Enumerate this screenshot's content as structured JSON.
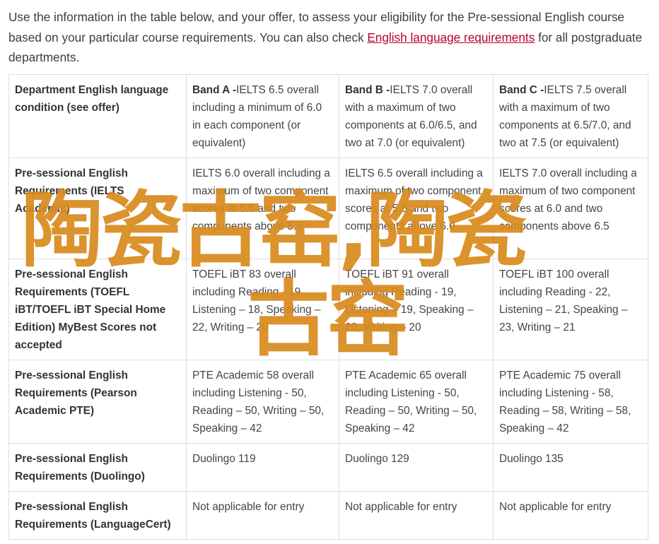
{
  "intro": {
    "text_before": "Use the information in the table below, and your offer, to assess your eligibility for the Pre-sessional English course based on your particular course requirements. You can also check ",
    "link": "English language requirements",
    "text_after": " for all postgraduate departments."
  },
  "table": {
    "header": {
      "col1": "Department English language condition (see offer)",
      "bands": [
        {
          "band": "Band A -",
          "desc": "IELTS 6.5 overall including a minimum of 6.0 in each component (or equivalent)"
        },
        {
          "band": "Band B -",
          "desc": "IELTS 7.0 overall with a maximum of two components at 6.0/6.5, and two at 7.0 (or equivalent)"
        },
        {
          "band": "Band C -",
          "desc": "IELTS 7.5 overall with a maximum of two components at 6.5/7.0, and two at 7.5 (or equivalent)"
        }
      ]
    },
    "rows": [
      {
        "label": "Pre-sessional English Requirements (IELTS Academic)",
        "cells": [
          "IELTS 6.0 overall including a maximum of two component scores at 5.5 and two components above 5.5",
          "IELTS 6.5 overall including a maximum of two component scores at 5.5 and two components above 6.0",
          "IELTS 7.0 overall including a maximum of two component scores at 6.0 and two components above 6.5"
        ]
      },
      {
        "label": "Pre-sessional English Requirements (TOEFL iBT/TOEFL iBT Special Home Edition) MyBest Scores not accepted",
        "cells": [
          "TOEFL iBT 83 overall including Reading - 19, Listening – 18, Speaking – 22, Writing – 20",
          "TOEFL iBT 91 overall including Reading - 19, Listening – 19, Speaking – 20, Writing – 20",
          "TOEFL iBT 100 overall including Reading - 22, Listening – 21, Speaking – 23, Writing – 21"
        ]
      },
      {
        "label": "Pre-sessional English Requirements (Pearson Academic PTE)",
        "cells": [
          "PTE Academic 58 overall including Listening - 50, Reading – 50, Writing – 50, Speaking – 42",
          "PTE Academic 65 overall including Listening - 50, Reading – 50, Writing – 50, Speaking – 42",
          "PTE Academic 75 overall including Listening - 58, Reading – 58, Writing – 58, Speaking – 42"
        ]
      },
      {
        "label": "Pre-sessional English Requirements (Duolingo)",
        "cells": [
          "Duolingo 119",
          "Duolingo 129",
          "Duolingo 135"
        ]
      },
      {
        "label": "Pre-sessional English Requirements (LanguageCert)",
        "cells": [
          "Not applicable for entry",
          "Not applicable for entry",
          "Not applicable for entry"
        ]
      }
    ]
  },
  "watermark": {
    "line1": "陶瓷古窑,陶瓷",
    "line2": "古窑"
  }
}
